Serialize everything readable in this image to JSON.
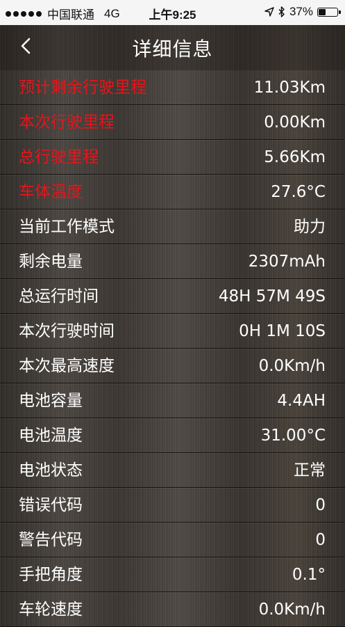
{
  "status_bar": {
    "carrier": "中国联通",
    "network": "4G",
    "time": "上午9:25",
    "battery_percent": "37%",
    "battery_level": 0.37,
    "icons": [
      "signal-dots-icon",
      "location-arrow-icon",
      "bluetooth-icon",
      "battery-icon"
    ]
  },
  "nav": {
    "title": "详细信息",
    "back_icon": "chevron-left-icon"
  },
  "colors": {
    "highlight_label": "#e8141a",
    "text": "#ffffff",
    "status_bar_bg": "#f5f5f5"
  },
  "rows": [
    {
      "label": "预计剩余行驶里程",
      "value": "11.03Km",
      "highlight": true
    },
    {
      "label": "本次行驶里程",
      "value": "0.00Km",
      "highlight": true
    },
    {
      "label": "总行驶里程",
      "value": "5.66Km",
      "highlight": true
    },
    {
      "label": "车体温度",
      "value": "27.6°C",
      "highlight": true
    },
    {
      "label": "当前工作模式",
      "value": "助力",
      "highlight": false
    },
    {
      "label": "剩余电量",
      "value": "2307mAh",
      "highlight": false
    },
    {
      "label": "总运行时间",
      "value": "48H 57M 49S",
      "highlight": false
    },
    {
      "label": "本次行驶时间",
      "value": "0H 1M 10S",
      "highlight": false
    },
    {
      "label": "本次最高速度",
      "value": "0.0Km/h",
      "highlight": false
    },
    {
      "label": "电池容量",
      "value": "4.4AH",
      "highlight": false
    },
    {
      "label": "电池温度",
      "value": "31.00°C",
      "highlight": false
    },
    {
      "label": "电池状态",
      "value": "正常",
      "highlight": false
    },
    {
      "label": "错误代码",
      "value": "0",
      "highlight": false
    },
    {
      "label": "警告代码",
      "value": "0",
      "highlight": false
    },
    {
      "label": "手把角度",
      "value": "0.1°",
      "highlight": false
    },
    {
      "label": "车轮速度",
      "value": "0.0Km/h",
      "highlight": false
    }
  ]
}
